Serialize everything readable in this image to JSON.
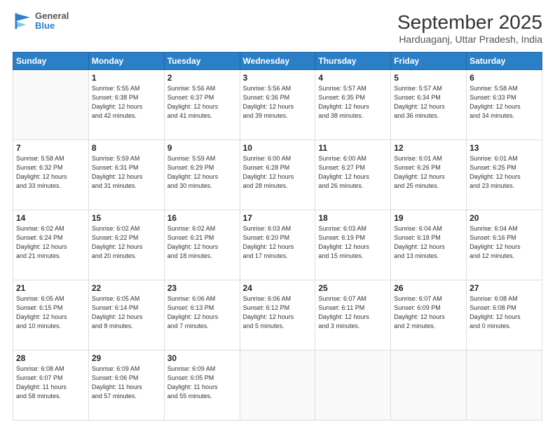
{
  "logo": {
    "line1": "General",
    "line2": "Blue"
  },
  "title": "September 2025",
  "subtitle": "Harduaganj, Uttar Pradesh, India",
  "weekdays": [
    "Sunday",
    "Monday",
    "Tuesday",
    "Wednesday",
    "Thursday",
    "Friday",
    "Saturday"
  ],
  "weeks": [
    [
      {
        "day": "",
        "detail": ""
      },
      {
        "day": "1",
        "detail": "Sunrise: 5:55 AM\nSunset: 6:38 PM\nDaylight: 12 hours\nand 42 minutes."
      },
      {
        "day": "2",
        "detail": "Sunrise: 5:56 AM\nSunset: 6:37 PM\nDaylight: 12 hours\nand 41 minutes."
      },
      {
        "day": "3",
        "detail": "Sunrise: 5:56 AM\nSunset: 6:36 PM\nDaylight: 12 hours\nand 39 minutes."
      },
      {
        "day": "4",
        "detail": "Sunrise: 5:57 AM\nSunset: 6:35 PM\nDaylight: 12 hours\nand 38 minutes."
      },
      {
        "day": "5",
        "detail": "Sunrise: 5:57 AM\nSunset: 6:34 PM\nDaylight: 12 hours\nand 36 minutes."
      },
      {
        "day": "6",
        "detail": "Sunrise: 5:58 AM\nSunset: 6:33 PM\nDaylight: 12 hours\nand 34 minutes."
      }
    ],
    [
      {
        "day": "7",
        "detail": "Sunrise: 5:58 AM\nSunset: 6:32 PM\nDaylight: 12 hours\nand 33 minutes."
      },
      {
        "day": "8",
        "detail": "Sunrise: 5:59 AM\nSunset: 6:31 PM\nDaylight: 12 hours\nand 31 minutes."
      },
      {
        "day": "9",
        "detail": "Sunrise: 5:59 AM\nSunset: 6:29 PM\nDaylight: 12 hours\nand 30 minutes."
      },
      {
        "day": "10",
        "detail": "Sunrise: 6:00 AM\nSunset: 6:28 PM\nDaylight: 12 hours\nand 28 minutes."
      },
      {
        "day": "11",
        "detail": "Sunrise: 6:00 AM\nSunset: 6:27 PM\nDaylight: 12 hours\nand 26 minutes."
      },
      {
        "day": "12",
        "detail": "Sunrise: 6:01 AM\nSunset: 6:26 PM\nDaylight: 12 hours\nand 25 minutes."
      },
      {
        "day": "13",
        "detail": "Sunrise: 6:01 AM\nSunset: 6:25 PM\nDaylight: 12 hours\nand 23 minutes."
      }
    ],
    [
      {
        "day": "14",
        "detail": "Sunrise: 6:02 AM\nSunset: 6:24 PM\nDaylight: 12 hours\nand 21 minutes."
      },
      {
        "day": "15",
        "detail": "Sunrise: 6:02 AM\nSunset: 6:22 PM\nDaylight: 12 hours\nand 20 minutes."
      },
      {
        "day": "16",
        "detail": "Sunrise: 6:02 AM\nSunset: 6:21 PM\nDaylight: 12 hours\nand 18 minutes."
      },
      {
        "day": "17",
        "detail": "Sunrise: 6:03 AM\nSunset: 6:20 PM\nDaylight: 12 hours\nand 17 minutes."
      },
      {
        "day": "18",
        "detail": "Sunrise: 6:03 AM\nSunset: 6:19 PM\nDaylight: 12 hours\nand 15 minutes."
      },
      {
        "day": "19",
        "detail": "Sunrise: 6:04 AM\nSunset: 6:18 PM\nDaylight: 12 hours\nand 13 minutes."
      },
      {
        "day": "20",
        "detail": "Sunrise: 6:04 AM\nSunset: 6:16 PM\nDaylight: 12 hours\nand 12 minutes."
      }
    ],
    [
      {
        "day": "21",
        "detail": "Sunrise: 6:05 AM\nSunset: 6:15 PM\nDaylight: 12 hours\nand 10 minutes."
      },
      {
        "day": "22",
        "detail": "Sunrise: 6:05 AM\nSunset: 6:14 PM\nDaylight: 12 hours\nand 8 minutes."
      },
      {
        "day": "23",
        "detail": "Sunrise: 6:06 AM\nSunset: 6:13 PM\nDaylight: 12 hours\nand 7 minutes."
      },
      {
        "day": "24",
        "detail": "Sunrise: 6:06 AM\nSunset: 6:12 PM\nDaylight: 12 hours\nand 5 minutes."
      },
      {
        "day": "25",
        "detail": "Sunrise: 6:07 AM\nSunset: 6:11 PM\nDaylight: 12 hours\nand 3 minutes."
      },
      {
        "day": "26",
        "detail": "Sunrise: 6:07 AM\nSunset: 6:09 PM\nDaylight: 12 hours\nand 2 minutes."
      },
      {
        "day": "27",
        "detail": "Sunrise: 6:08 AM\nSunset: 6:08 PM\nDaylight: 12 hours\nand 0 minutes."
      }
    ],
    [
      {
        "day": "28",
        "detail": "Sunrise: 6:08 AM\nSunset: 6:07 PM\nDaylight: 11 hours\nand 58 minutes."
      },
      {
        "day": "29",
        "detail": "Sunrise: 6:09 AM\nSunset: 6:06 PM\nDaylight: 11 hours\nand 57 minutes."
      },
      {
        "day": "30",
        "detail": "Sunrise: 6:09 AM\nSunset: 6:05 PM\nDaylight: 11 hours\nand 55 minutes."
      },
      {
        "day": "",
        "detail": ""
      },
      {
        "day": "",
        "detail": ""
      },
      {
        "day": "",
        "detail": ""
      },
      {
        "day": "",
        "detail": ""
      }
    ]
  ]
}
